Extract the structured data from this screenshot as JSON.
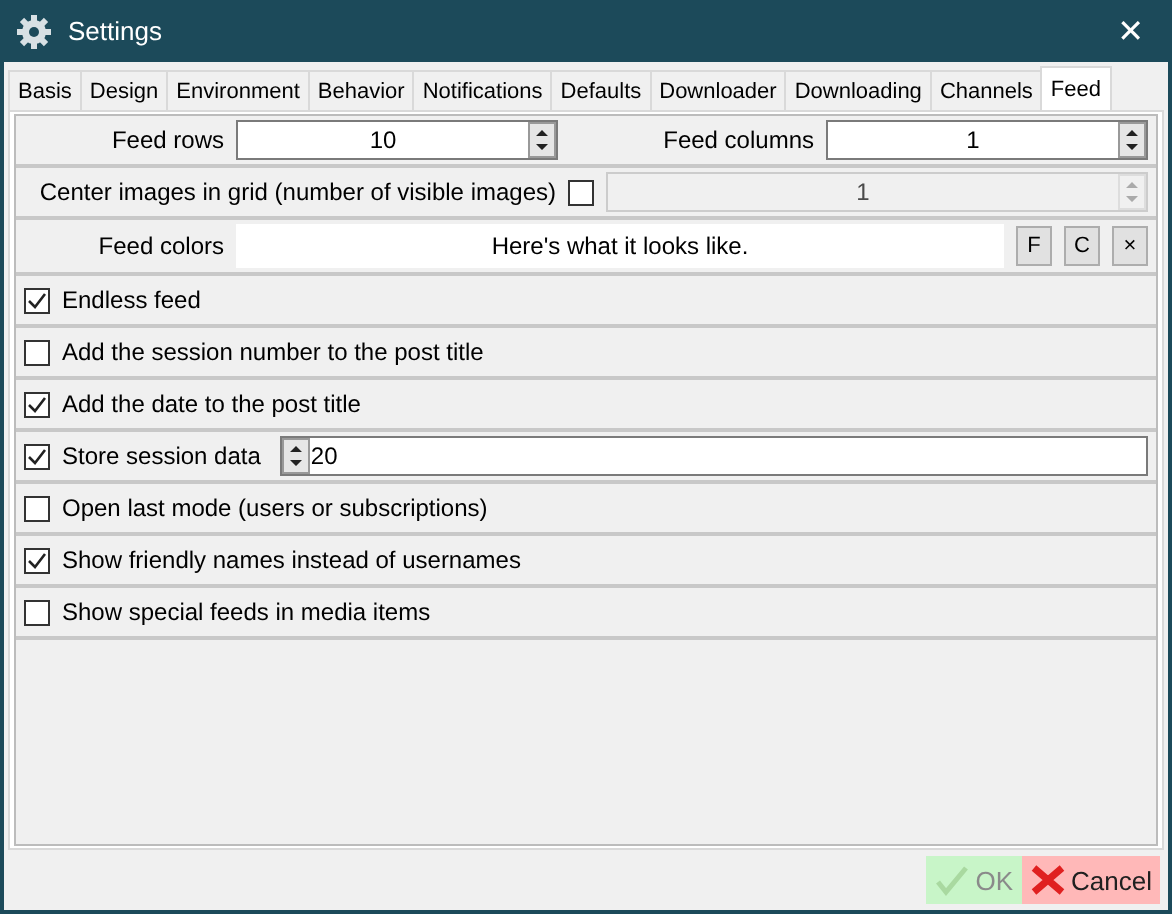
{
  "window": {
    "title": "Settings",
    "close": "✕"
  },
  "tabs": [
    {
      "label": "Basis",
      "selected": false
    },
    {
      "label": "Design",
      "selected": false
    },
    {
      "label": "Environment",
      "selected": false
    },
    {
      "label": "Behavior",
      "selected": false
    },
    {
      "label": "Notifications",
      "selected": false
    },
    {
      "label": "Defaults",
      "selected": false
    },
    {
      "label": "Downloader",
      "selected": false
    },
    {
      "label": "Downloading",
      "selected": false
    },
    {
      "label": "Channels",
      "selected": false
    },
    {
      "label": "Feed",
      "selected": true
    }
  ],
  "feed_rows": {
    "label": "Feed rows",
    "value": "10"
  },
  "feed_columns": {
    "label": "Feed columns",
    "value": "1"
  },
  "center_images": {
    "label": "Center images in grid (number of visible images)",
    "checked": false,
    "value": "1",
    "disabled": true
  },
  "feed_colors": {
    "label": "Feed colors",
    "preview": "Here's what it looks like.",
    "buttons": [
      "F",
      "C",
      "×"
    ]
  },
  "options": [
    {
      "label": "Endless feed",
      "checked": true
    },
    {
      "label": "Add the session number to the post title",
      "checked": false
    },
    {
      "label": "Add the date to the post title",
      "checked": true
    },
    {
      "label": "Store session data",
      "checked": true,
      "value": "20"
    },
    {
      "label": "Open last mode (users or subscriptions)",
      "checked": false
    },
    {
      "label": "Show friendly names instead of usernames",
      "checked": true
    },
    {
      "label": "Show special feeds in media items",
      "checked": false
    }
  ],
  "footer": {
    "ok": {
      "label": "OK",
      "disabled": true
    },
    "cancel": {
      "label": "Cancel"
    }
  }
}
